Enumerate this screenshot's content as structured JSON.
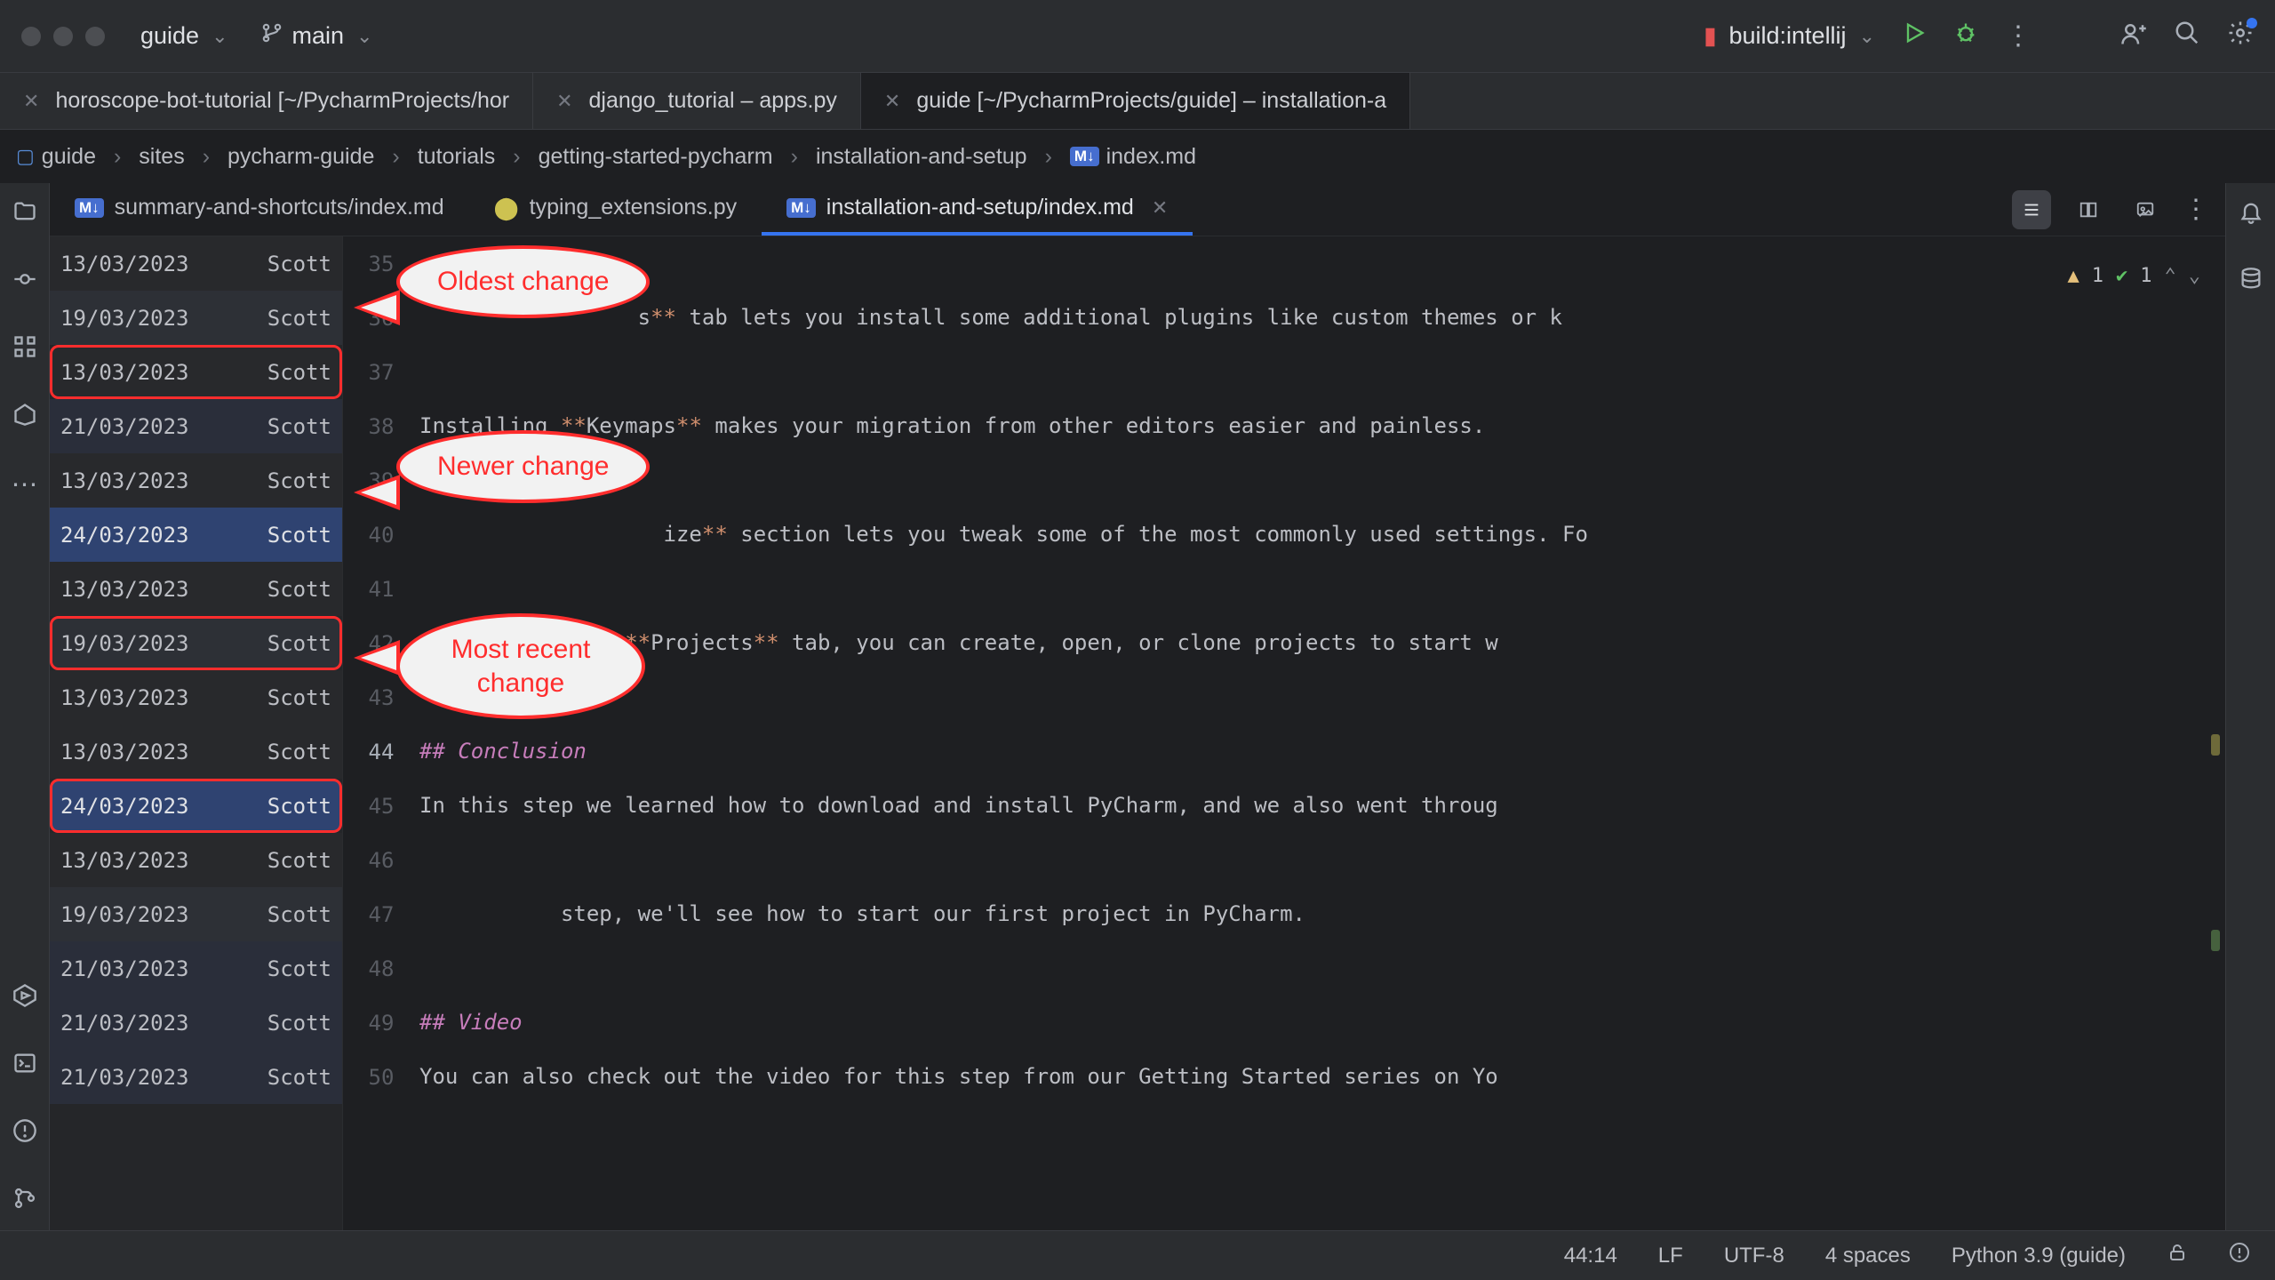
{
  "titlebar": {
    "project": "guide",
    "branch": "main",
    "run_config": "build:intellij"
  },
  "window_tabs": [
    {
      "label": "horoscope-bot-tutorial [~/PycharmProjects/hor",
      "closable": true,
      "active": false
    },
    {
      "label": "django_tutorial – apps.py",
      "closable": true,
      "active": false
    },
    {
      "label": "guide [~/PycharmProjects/guide] – installation-a",
      "closable": true,
      "active": true
    }
  ],
  "breadcrumb": [
    "guide",
    "sites",
    "pycharm-guide",
    "tutorials",
    "getting-started-pycharm",
    "installation-and-setup",
    "index.md"
  ],
  "editor_tabs": [
    {
      "label": "summary-and-shortcuts/index.md",
      "kind": "md",
      "active": false
    },
    {
      "label": "typing_extensions.py",
      "kind": "py",
      "active": false
    },
    {
      "label": "installation-and-setup/index.md",
      "kind": "md",
      "active": true
    }
  ],
  "inspections": {
    "warn": "1",
    "ok": "1"
  },
  "blame": [
    {
      "date": "13/03/2023",
      "author": "Scott",
      "shade": "shade1",
      "ring": false,
      "highlight": false
    },
    {
      "date": "19/03/2023",
      "author": "Scott",
      "shade": "shade2",
      "ring": false,
      "highlight": false
    },
    {
      "date": "13/03/2023",
      "author": "Scott",
      "shade": "shade1",
      "ring": true,
      "highlight": false
    },
    {
      "date": "21/03/2023",
      "author": "Scott",
      "shade": "shade3",
      "ring": false,
      "highlight": false
    },
    {
      "date": "13/03/2023",
      "author": "Scott",
      "shade": "shade1",
      "ring": false,
      "highlight": false
    },
    {
      "date": "24/03/2023",
      "author": "Scott",
      "shade": "",
      "ring": false,
      "highlight": true
    },
    {
      "date": "13/03/2023",
      "author": "Scott",
      "shade": "shade1",
      "ring": false,
      "highlight": false
    },
    {
      "date": "19/03/2023",
      "author": "Scott",
      "shade": "shade2",
      "ring": true,
      "highlight": false
    },
    {
      "date": "13/03/2023",
      "author": "Scott",
      "shade": "shade1",
      "ring": false,
      "highlight": false
    },
    {
      "date": "13/03/2023",
      "author": "Scott",
      "shade": "shade1",
      "ring": false,
      "highlight": false
    },
    {
      "date": "24/03/2023",
      "author": "Scott",
      "shade": "",
      "ring": true,
      "highlight": true
    },
    {
      "date": "13/03/2023",
      "author": "Scott",
      "shade": "shade1",
      "ring": false,
      "highlight": false
    },
    {
      "date": "19/03/2023",
      "author": "Scott",
      "shade": "shade2",
      "ring": false,
      "highlight": false
    },
    {
      "date": "21/03/2023",
      "author": "Scott",
      "shade": "shade3",
      "ring": false,
      "highlight": false
    },
    {
      "date": "21/03/2023",
      "author": "Scott",
      "shade": "shade3",
      "ring": false,
      "highlight": false
    },
    {
      "date": "21/03/2023",
      "author": "Scott",
      "shade": "shade3",
      "ring": false,
      "highlight": false
    }
  ],
  "lines": [
    {
      "num": "35",
      "html": ""
    },
    {
      "num": "36",
      "html": "                 s<span class='bold'>**</span> tab lets you install some additional plugins like custom themes or k"
    },
    {
      "num": "37",
      "html": ""
    },
    {
      "num": "38",
      "html": "Installing <span class='bold'>**</span>Keymaps<span class='bold'>**</span> makes your migration from other editors easier and painless."
    },
    {
      "num": "39",
      "html": ""
    },
    {
      "num": "40",
      "html": "                   ize<span class='bold'>**</span> section lets you tweak some of the most commonly used settings. Fo"
    },
    {
      "num": "41",
      "html": ""
    },
    {
      "num": "42",
      "html": "Finally, on the <span class='bold'>**</span>Projects<span class='bold'>**</span> tab, you can create, open, or clone projects to start w"
    },
    {
      "num": "43",
      "html": ""
    },
    {
      "num": "44",
      "html": "<span class='mdhead'>## Conclusion</span>"
    },
    {
      "num": "45",
      "html": "In this step we learned how to download and install PyCharm, and we also went throug"
    },
    {
      "num": "46",
      "html": ""
    },
    {
      "num": "47",
      "html": "           step, we'll see how to start our first project in PyCharm."
    },
    {
      "num": "48",
      "html": ""
    },
    {
      "num": "49",
      "html": "<span class='mdhead'>## Video</span>"
    },
    {
      "num": "50",
      "html": "You can also check out the video for this step from our Getting Started series on Yo"
    }
  ],
  "statusbar": {
    "pos": "44:14",
    "lineend": "LF",
    "encoding": "UTF-8",
    "indent": "4 spaces",
    "interpreter": "Python 3.9 (guide)"
  },
  "annotations": {
    "a": "Oldest change",
    "b": "Newer change",
    "c1": "Most recent",
    "c2": "change"
  }
}
